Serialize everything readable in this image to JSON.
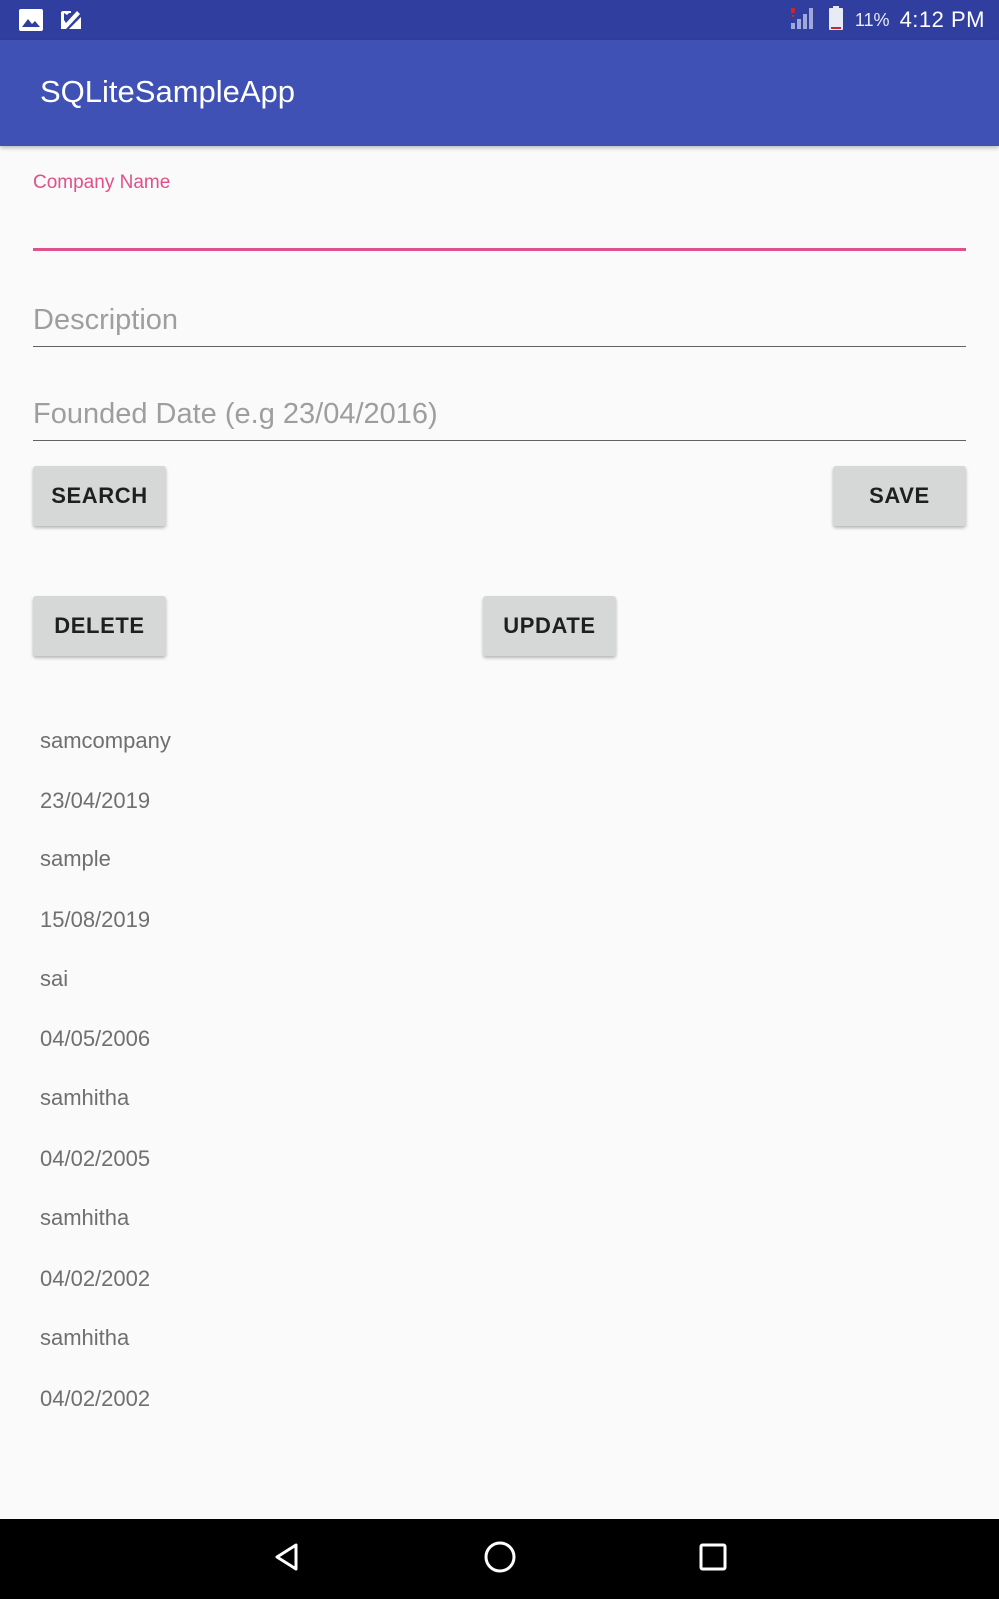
{
  "status_bar": {
    "battery_percent": "11%",
    "time": "4:12 PM",
    "icons": [
      "image-icon",
      "checklist-icon",
      "signal-icon",
      "battery-icon"
    ]
  },
  "app_bar": {
    "title": "SQLiteSampleApp"
  },
  "form": {
    "company_name_label": "Company Name",
    "company_name_value": "",
    "description_placeholder": "Description",
    "founded_date_placeholder": "Founded Date (e.g 23/04/2016)"
  },
  "buttons": {
    "search": "SEARCH",
    "save": "SAVE",
    "delete": "DELETE",
    "update": "UPDATE"
  },
  "list": {
    "items": [
      "samcompany",
      "23/04/2019",
      "sample",
      "15/08/2019",
      "sai",
      "04/05/2006",
      "samhitha",
      "04/02/2005",
      "samhitha",
      "04/02/2002",
      "samhitha",
      "04/02/2002"
    ]
  },
  "nav_bar": {
    "icons": [
      "back-icon",
      "home-icon",
      "recents-icon"
    ]
  },
  "colors": {
    "status_bar": "#303f9f",
    "app_bar": "#3f51b5",
    "accent": "#e0508a",
    "button": "#d6d7d7"
  }
}
